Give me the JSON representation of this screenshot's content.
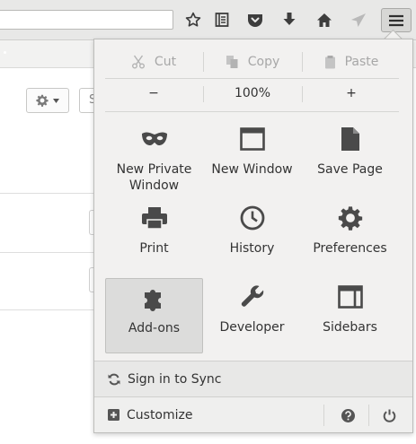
{
  "menu": {
    "edit": {
      "cut": "Cut",
      "copy": "Copy",
      "paste": "Paste"
    },
    "zoom": {
      "out": "−",
      "level": "100%",
      "in": "+"
    },
    "tiles": {
      "private_line1": "New Private",
      "private_line2": "Window",
      "new_window": "New Window",
      "save_page": "Save Page",
      "print": "Print",
      "history": "History",
      "preferences": "Preferences",
      "addons": "Add-ons",
      "developer": "Developer",
      "sidebars": "Sidebars"
    },
    "sync": "Sign in to Sync",
    "customize": "Customize"
  },
  "page": {
    "search_stub": "S"
  },
  "icons": {
    "toolbar": [
      "star-icon",
      "reading-list-icon",
      "pocket-icon",
      "download-icon",
      "home-icon",
      "share-icon",
      "hamburger-menu-icon"
    ],
    "panel": [
      "scissors-icon",
      "copy-icon",
      "clipboard-icon",
      "mask-icon",
      "window-icon",
      "page-icon",
      "printer-icon",
      "clock-icon",
      "gear-icon",
      "puzzle-icon",
      "wrench-icon",
      "sidebar-icon",
      "sync-icon",
      "plus-box-icon",
      "help-icon",
      "power-icon"
    ]
  },
  "colors": {
    "icon": "#4a4a4a",
    "disabled_text": "#a7a7a7",
    "panel_bg": "#f2f1f0",
    "selected_tile": "#dcdcdb"
  }
}
